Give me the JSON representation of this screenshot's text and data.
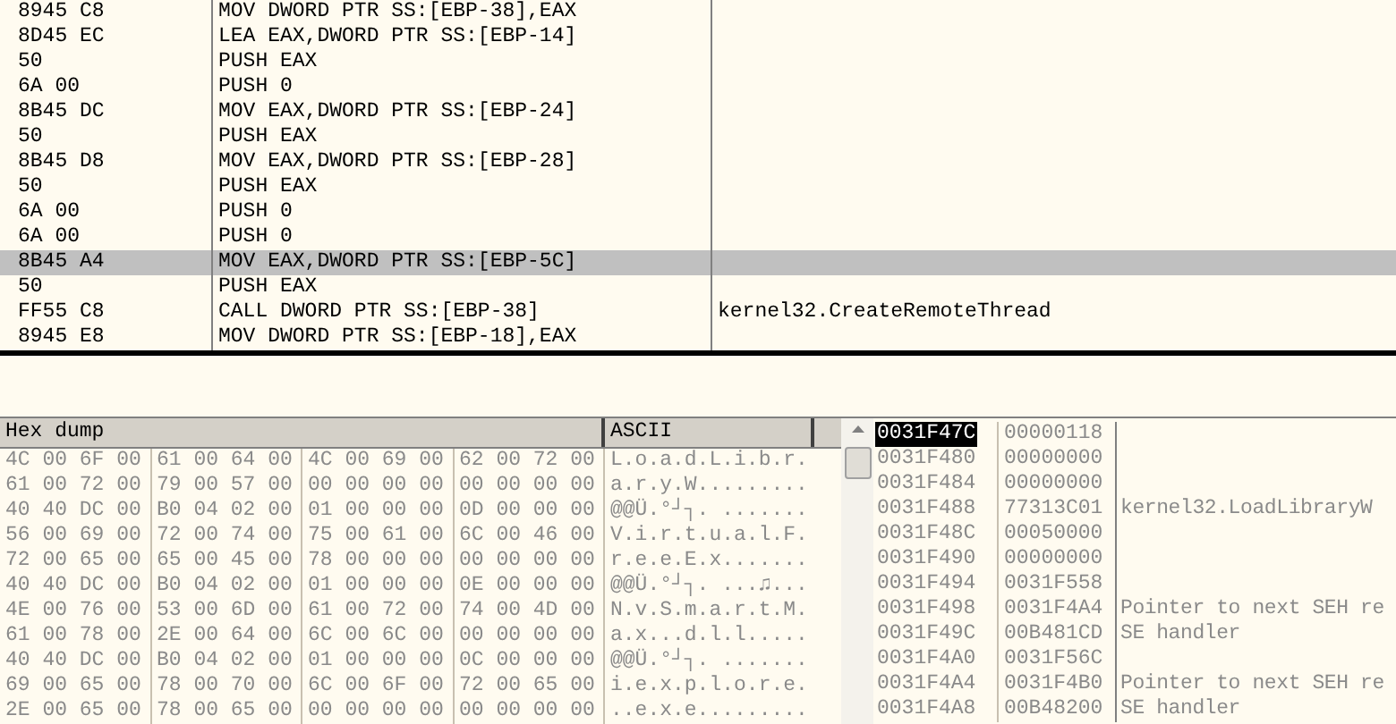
{
  "disassembly": {
    "rows": [
      {
        "hex": "8945 C8",
        "instruction": "MOV DWORD PTR SS:[EBP-38],EAX",
        "selected": false
      },
      {
        "hex": "8D45 EC",
        "instruction": "LEA EAX,DWORD PTR SS:[EBP-14]",
        "selected": false
      },
      {
        "hex": "50",
        "instruction": "PUSH EAX",
        "selected": false
      },
      {
        "hex": "6A 00",
        "instruction": "PUSH 0",
        "selected": false
      },
      {
        "hex": "8B45 DC",
        "instruction": "MOV EAX,DWORD PTR SS:[EBP-24]",
        "selected": false
      },
      {
        "hex": "50",
        "instruction": "PUSH EAX",
        "selected": false
      },
      {
        "hex": "8B45 D8",
        "instruction": "MOV EAX,DWORD PTR SS:[EBP-28]",
        "selected": false
      },
      {
        "hex": "50",
        "instruction": "PUSH EAX",
        "selected": false
      },
      {
        "hex": "6A 00",
        "instruction": "PUSH 0",
        "selected": false
      },
      {
        "hex": "6A 00",
        "instruction": "PUSH 0",
        "selected": false
      },
      {
        "hex": "8B45 A4",
        "instruction": "MOV EAX,DWORD PTR SS:[EBP-5C]",
        "selected": true
      },
      {
        "hex": "50",
        "instruction": "PUSH EAX",
        "selected": false
      },
      {
        "hex": "FF55 C8",
        "instruction": "CALL DWORD PTR SS:[EBP-38]",
        "comment": "kernel32.CreateRemoteThread",
        "selected": false
      },
      {
        "hex": "8945 E8",
        "instruction": "MOV DWORD PTR SS:[EBP-18],EAX",
        "selected": false
      }
    ]
  },
  "dump": {
    "columns": [
      "Hex dump",
      "ASCII"
    ],
    "rows": [
      {
        "bytes": [
          "4C 00 6F 00",
          "61 00 64 00",
          "4C 00 69 00",
          "62 00 72 00"
        ],
        "ascii": "L.o.a.d.L.i.b.r."
      },
      {
        "bytes": [
          "61 00 72 00",
          "79 00 57 00",
          "00 00 00 00",
          "00 00 00 00"
        ],
        "ascii": "a.r.y.W........."
      },
      {
        "bytes": [
          "40 40 DC 00",
          "B0 04 02 00",
          "01 00 00 00",
          "0D 00 00 00"
        ],
        "ascii": "@@Ü.°┘┐. ......."
      },
      {
        "bytes": [
          "56 00 69 00",
          "72 00 74 00",
          "75 00 61 00",
          "6C 00 46 00"
        ],
        "ascii": "V.i.r.t.u.a.l.F."
      },
      {
        "bytes": [
          "72 00 65 00",
          "65 00 45 00",
          "78 00 00 00",
          "00 00 00 00"
        ],
        "ascii": "r.e.e.E.x......."
      },
      {
        "bytes": [
          "40 40 DC 00",
          "B0 04 02 00",
          "01 00 00 00",
          "0E 00 00 00"
        ],
        "ascii": "@@Ü.°┘┐. ...♫..."
      },
      {
        "bytes": [
          "4E 00 76 00",
          "53 00 6D 00",
          "61 00 72 00",
          "74 00 4D 00"
        ],
        "ascii": "N.v.S.m.a.r.t.M."
      },
      {
        "bytes": [
          "61 00 78 00",
          "2E 00 64 00",
          "6C 00 6C 00",
          "00 00 00 00"
        ],
        "ascii": "a.x...d.l.l....."
      },
      {
        "bytes": [
          "40 40 DC 00",
          "B0 04 02 00",
          "01 00 00 00",
          "0C 00 00 00"
        ],
        "ascii": "@@Ü.°┘┐. ......."
      },
      {
        "bytes": [
          "69 00 65 00",
          "78 00 70 00",
          "6C 00 6F 00",
          "72 00 65 00"
        ],
        "ascii": "i.e.x.p.l.o.r.e."
      },
      {
        "bytes": [
          "2E 00 65 00",
          "78 00 65 00",
          "00 00 00 00",
          "00 00 00 00"
        ],
        "ascii": "..e.x.e........."
      }
    ]
  },
  "stack": {
    "rows": [
      {
        "address": "0031F47C",
        "value": "00000118",
        "selected": true
      },
      {
        "address": "0031F480",
        "value": "00000000",
        "selected": false
      },
      {
        "address": "0031F484",
        "value": "00000000",
        "selected": false
      },
      {
        "address": "0031F488",
        "value": "77313C01",
        "comment": "kernel32.LoadLibraryW",
        "selected": false
      },
      {
        "address": "0031F48C",
        "value": "00050000",
        "selected": false
      },
      {
        "address": "0031F490",
        "value": "00000000",
        "selected": false
      },
      {
        "address": "0031F494",
        "value": "0031F558",
        "selected": false
      },
      {
        "address": "0031F498",
        "value": "0031F4A4",
        "comment": "Pointer to next SEH re",
        "selected": false
      },
      {
        "address": "0031F49C",
        "value": "00B481CD",
        "comment": "SE handler",
        "selected": false
      },
      {
        "address": "0031F4A0",
        "value": "0031F56C",
        "selected": false
      },
      {
        "address": "0031F4A4",
        "value": "0031F4B0",
        "comment": "Pointer to next SEH re",
        "selected": false
      },
      {
        "address": "0031F4A8",
        "value": "00B48200",
        "comment": "SE handler",
        "selected": false
      }
    ]
  }
}
